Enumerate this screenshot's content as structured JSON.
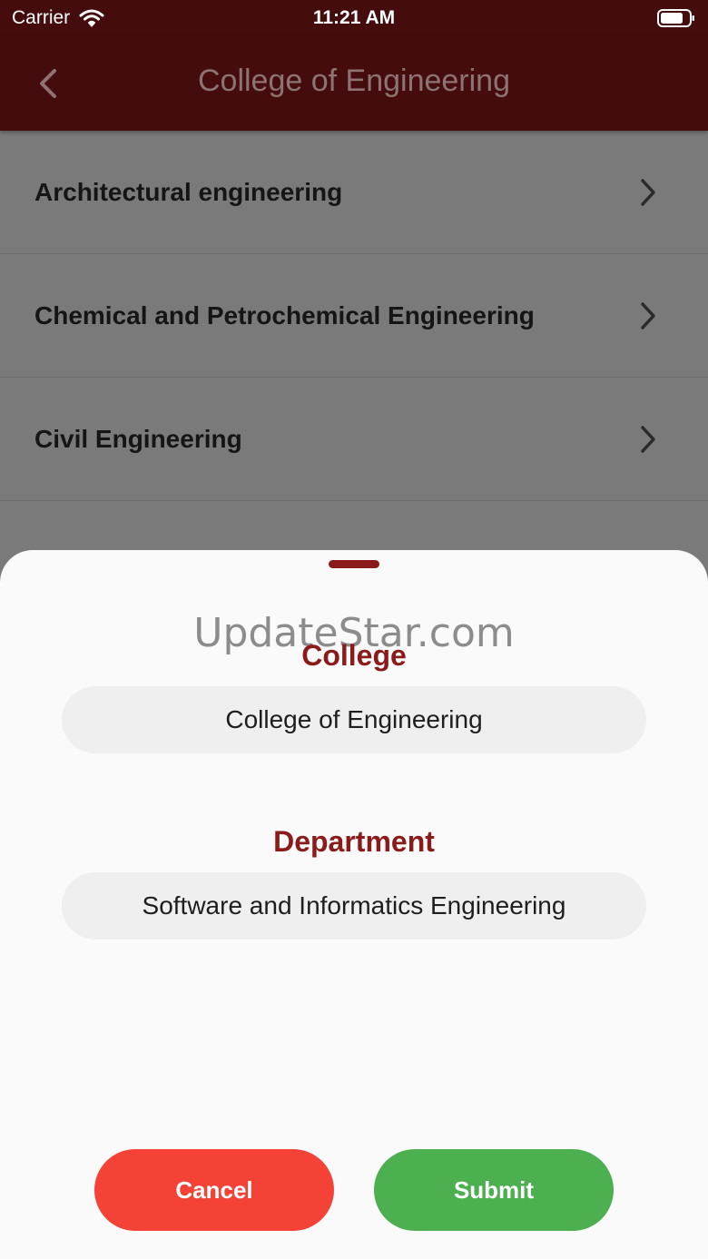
{
  "status_bar": {
    "carrier": "Carrier",
    "time": "11:21 AM"
  },
  "nav": {
    "title": "College of Engineering"
  },
  "list": {
    "items": [
      {
        "label": "Architectural engineering"
      },
      {
        "label": "Chemical and Petrochemical Engineering"
      },
      {
        "label": "Civil Engineering"
      },
      {
        "label": ""
      }
    ]
  },
  "sheet": {
    "watermark": "UpdateStar.com",
    "college_label": "College",
    "college_value": "College of Engineering",
    "department_label": "Department",
    "department_value": "Software and Informatics Engineering",
    "cancel_label": "Cancel",
    "submit_label": "Submit"
  },
  "colors": {
    "header_bg": "#440c0c",
    "accent": "#8b1a1a",
    "cancel": "#f44336",
    "submit": "#4caf50"
  }
}
